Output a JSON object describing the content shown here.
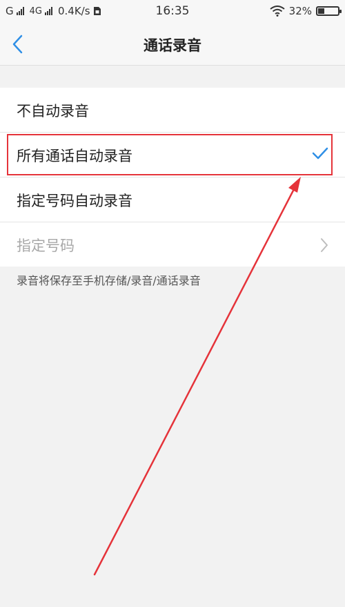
{
  "status_bar": {
    "carrier1": "G",
    "carrier2": "4G",
    "speed": "0.4K/s",
    "time": "16:35",
    "battery": "32%",
    "battery_level": 0.32
  },
  "nav": {
    "title": "通话录音",
    "back_icon": "chevron-left-icon"
  },
  "options": [
    {
      "label": "不自动录音",
      "selected": false
    },
    {
      "label": "所有通话自动录音",
      "selected": true
    },
    {
      "label": "指定号码自动录音",
      "selected": false
    },
    {
      "label": "指定号码",
      "disabled": true
    }
  ],
  "note": "录音将保存至手机存储/录音/通话录音",
  "colors": {
    "accent": "#2f8fe6",
    "annotation": "#e5333a"
  }
}
